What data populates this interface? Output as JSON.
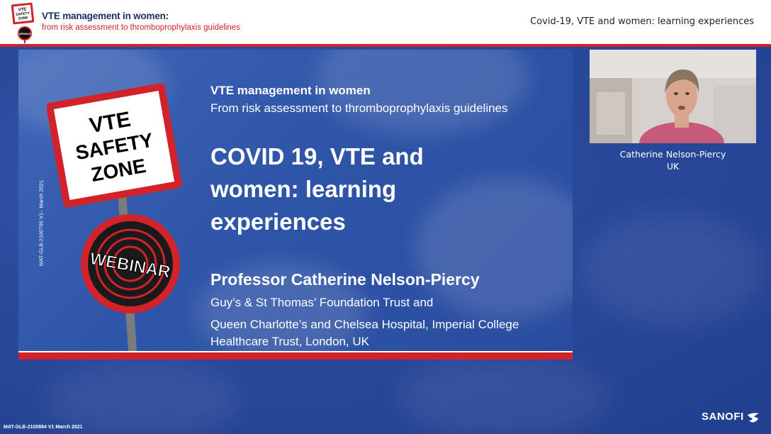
{
  "header": {
    "title": "VTE management in women:",
    "subtitle": "from risk assessment to thromboprophylaxis guidelines",
    "session_title": "Covid-19, VTE and women: learning experiences",
    "logo_text": [
      "VTE",
      "SAFETY",
      "ZONE",
      "WEBINAR"
    ]
  },
  "slide": {
    "line1": "VTE management in women",
    "line2": "From risk assessment to thromboprophylaxis guidelines",
    "title": "COVID 19, VTE and women: learning experiences",
    "speaker": "Professor Catherine Nelson-Piercy",
    "affiliation1": "Guy’s & St Thomas’ Foundation Trust and",
    "affiliation2": "Queen Charlotte’s and Chelsea Hospital, Imperial College Healthcare Trust, London, UK",
    "side_code": "MAT-GLB-2100795  V1– March 2021",
    "sign_text": [
      "VTE",
      "SAFETY",
      "ZONE",
      "WEBINAR"
    ]
  },
  "webcam": {
    "name": "Catherine Nelson-Piercy",
    "country": "UK"
  },
  "footer": {
    "code": "MAT-GLB-2100884 V1 March 2021",
    "brand": "SANOFI"
  },
  "colors": {
    "accent_red": "#d2222a",
    "background_blue": "#2a4a9c",
    "header_navy": "#1b2f6b"
  }
}
